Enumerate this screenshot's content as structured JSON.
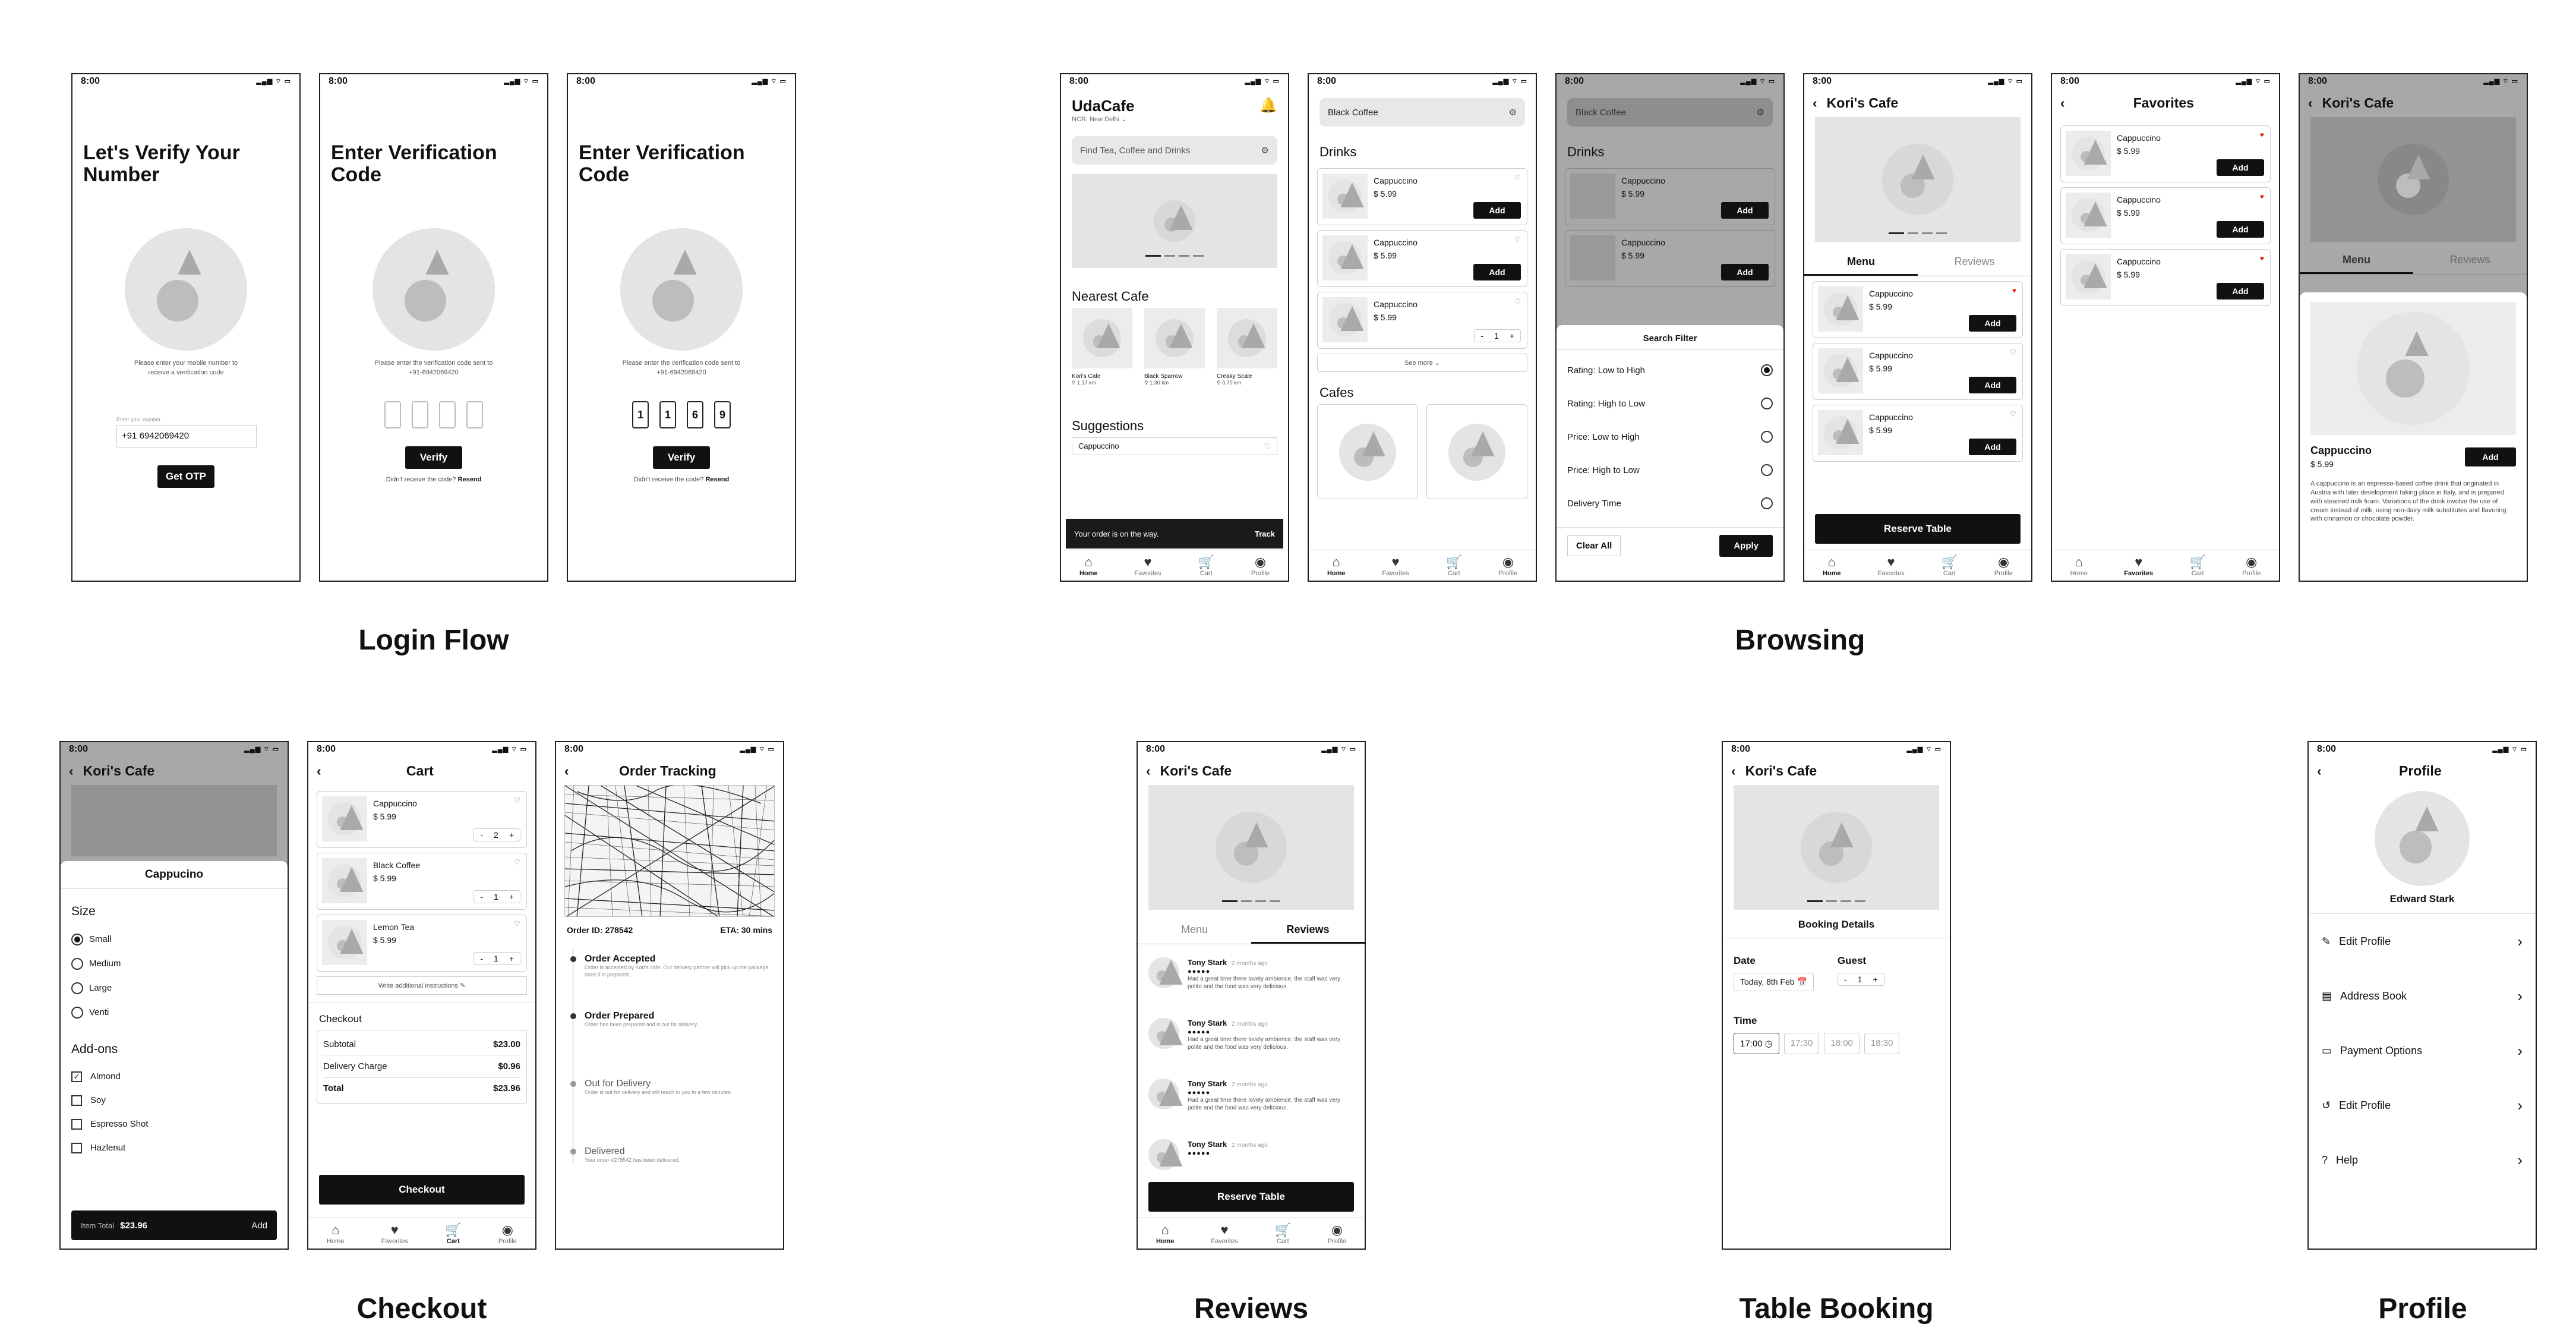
{
  "status_time": "8:00",
  "status_icons": "▂▄▆ ⌔ ▭",
  "captions": {
    "login": "Login Flow",
    "browsing": "Browsing",
    "checkout": "Checkout",
    "reviews": "Reviews",
    "table": "Table Booking",
    "profile": "Profile"
  },
  "login": {
    "verify_title": "Let's Verify Your Number",
    "verify_hint": "Please enter your mobile number to receive a verification code",
    "phone_label": "Enter your number",
    "phone_value": "+91 6942069420",
    "get_otp": "Get OTP",
    "code_title": "Enter Verification Code",
    "code_hint": "Please enter the verification code sent to +91-6942069420",
    "verify_btn": "Verify",
    "resend_q": "Didn't receive the code?",
    "resend": "Resend",
    "digits": [
      "1",
      "1",
      "6",
      "9"
    ]
  },
  "home": {
    "brand": "UdaCafe",
    "location": "NCR, New Delhi ⌄",
    "search_placeholder": "Find Tea, Coffee and Drinks",
    "nearest": "Nearest Cafe",
    "cafes": [
      {
        "name": "Kori's Cafe",
        "dist": "1.37 km"
      },
      {
        "name": "Black Sparrow",
        "dist": "1.30 km"
      },
      {
        "name": "Creaky Scale",
        "dist": "0.70 km"
      }
    ],
    "suggestions": "Suggestions",
    "suggest_item": "Cappuccino",
    "toast": "Your order is on the way.",
    "track": "Track"
  },
  "nav": {
    "home": "Home",
    "favorites": "Favorites",
    "cart": "Cart",
    "profile": "Profile"
  },
  "search_results": {
    "query": "Black Coffee",
    "drinks": "Drinks",
    "items": [
      {
        "name": "Cappuccino",
        "price": "$ 5.99"
      },
      {
        "name": "Cappuccino",
        "price": "$ 5.99"
      },
      {
        "name": "Cappuccino",
        "price": "$ 5.99"
      }
    ],
    "qty": "1",
    "add": "Add",
    "see_more": "See more ⌄",
    "cafes": "Cafes"
  },
  "filter": {
    "title": "Search Filter",
    "options": [
      "Rating: Low to High",
      "Rating: High to Low",
      "Price: Low to High",
      "Price: High to Low",
      "Delivery Time"
    ],
    "clear": "Clear All",
    "apply": "Apply"
  },
  "cafe": {
    "name": "Kori's Cafe",
    "tab_menu": "Menu",
    "tab_reviews": "Reviews",
    "reserve": "Reserve Table"
  },
  "favorites": {
    "title": "Favorites"
  },
  "product": {
    "name": "Cappuccino",
    "price": "$ 5.99",
    "description": "A cappuccino is an espresso-based coffee drink that originated in Austria with later development taking place in Italy, and is prepared with steamed milk foam. Variations of the drink involve the use of cream instead of milk, using non-dairy milk substitutes and flavoring with cinnamon or chocolate powder."
  },
  "customize": {
    "title": "Cappucino",
    "size": "Size",
    "sizes": [
      "Small",
      "Medium",
      "Large",
      "Venti"
    ],
    "addons": "Add-ons",
    "addon_list": [
      "Almond",
      "Soy",
      "Espresso Shot",
      "Hazlenut"
    ],
    "item_total": "Item Total",
    "total": "$23.96",
    "add": "Add"
  },
  "cart": {
    "title": "Cart",
    "items": [
      {
        "name": "Cappuccino",
        "price": "$ 5.99",
        "qty": "2"
      },
      {
        "name": "Black Coffee",
        "price": "$ 5.99",
        "qty": "1"
      },
      {
        "name": "Lemon Tea",
        "price": "$ 5.99",
        "qty": "1"
      }
    ],
    "instructions": "Write additional instructions ✎",
    "checkout": "Checkout",
    "subtotal_label": "Subtotal",
    "subtotal": "$23.00",
    "delivery_label": "Delivery Charge",
    "delivery": "$0.96",
    "total_label": "Total",
    "total": "$23.96",
    "checkout_btn": "Checkout"
  },
  "tracking": {
    "title": "Order Tracking",
    "order_id": "Order ID: 278542",
    "eta": "ETA: 30 mins",
    "steps": [
      {
        "title": "Order Accepted",
        "desc": "Order is accepted by Kori's cafe. Our delivery partner will pick up the package once it is prepared."
      },
      {
        "title": "Order Prepared",
        "desc": "Order has been prepared and is out for delivery."
      },
      {
        "title": "Out for Delivery",
        "desc": "Order is out for delivery and will reach to you in a few minutes."
      },
      {
        "title": "Delivered",
        "desc": "Your order #278542 has been delivered."
      }
    ]
  },
  "reviews": {
    "items": [
      {
        "name": "Tony Stark",
        "time": "2 months ago",
        "text": "Had a great time there lovely ambience, the staff was very polite and the food was very delicious."
      },
      {
        "name": "Tony Stark",
        "time": "2 months ago",
        "text": "Had a great time there lovely ambience, the staff was very polite and the food was very delicious."
      },
      {
        "name": "Tony Stark",
        "time": "2 months ago",
        "text": "Had a great time there lovely ambience, the staff was very polite and the food was very delicious."
      },
      {
        "name": "Tony Stark",
        "time": "2 months ago",
        "text": ""
      }
    ],
    "stars": "●●●●●"
  },
  "booking": {
    "title": "Booking Details",
    "date_label": "Date",
    "date": "Today, 8th Feb",
    "guest_label": "Guest",
    "guests": "1",
    "time_label": "Time",
    "slots": [
      "17:00",
      "17:30",
      "18:00",
      "18:30"
    ]
  },
  "profile": {
    "title": "Profile",
    "name": "Edward Stark",
    "items": [
      "Edit Profile",
      "Address Book",
      "Payment Options",
      "Edit Profile",
      "Help"
    ]
  }
}
